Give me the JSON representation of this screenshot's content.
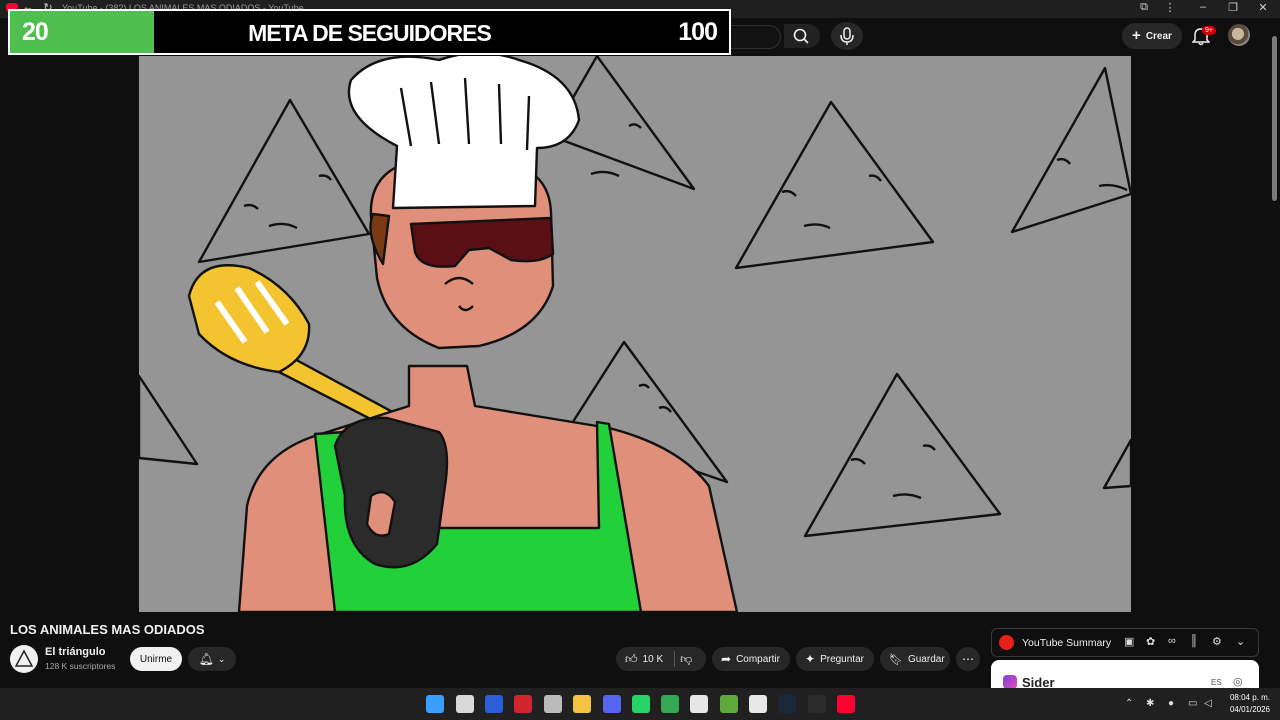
{
  "browser": {
    "tab_title": "YouTube - (382) LOS ANIMALES MAS ODIADOS - YouTube"
  },
  "header": {
    "create_label": "Crear",
    "notifications_badge": "9+"
  },
  "overlay": {
    "goal_current": "20",
    "goal_title": "META DE SEGUIDORES",
    "goal_target": "100",
    "goal_progress": 0.2,
    "goal_color": "#4fc04f"
  },
  "video": {
    "title": "LOS ANIMALES MAS ODIADOS",
    "channel_name": "El triángulo",
    "subscribers": "128 K suscriptores",
    "join_label": "Unirme",
    "like_count": "10 K",
    "share_label": "Compartir",
    "ask_label": "Preguntar",
    "save_label": "Guardar"
  },
  "extension": {
    "name": "YouTube Summary",
    "sider_name": "Sider",
    "sider_lang": "ES"
  },
  "taskbar": {
    "time": "08:04 p. m.",
    "date": "04/01/2026",
    "apps": [
      "windows-start",
      "file-explorer",
      "mail",
      "autocad",
      "chrome",
      "folder",
      "discord",
      "whatsapp",
      "chrome-2",
      "epic-x",
      "minecraft",
      "store",
      "steam",
      "epic-games",
      "youtube"
    ]
  },
  "colors": {
    "accent": "#ff0033",
    "background": "#0f0f0f",
    "apron": "#22d03a",
    "skin": "#e0907a"
  }
}
